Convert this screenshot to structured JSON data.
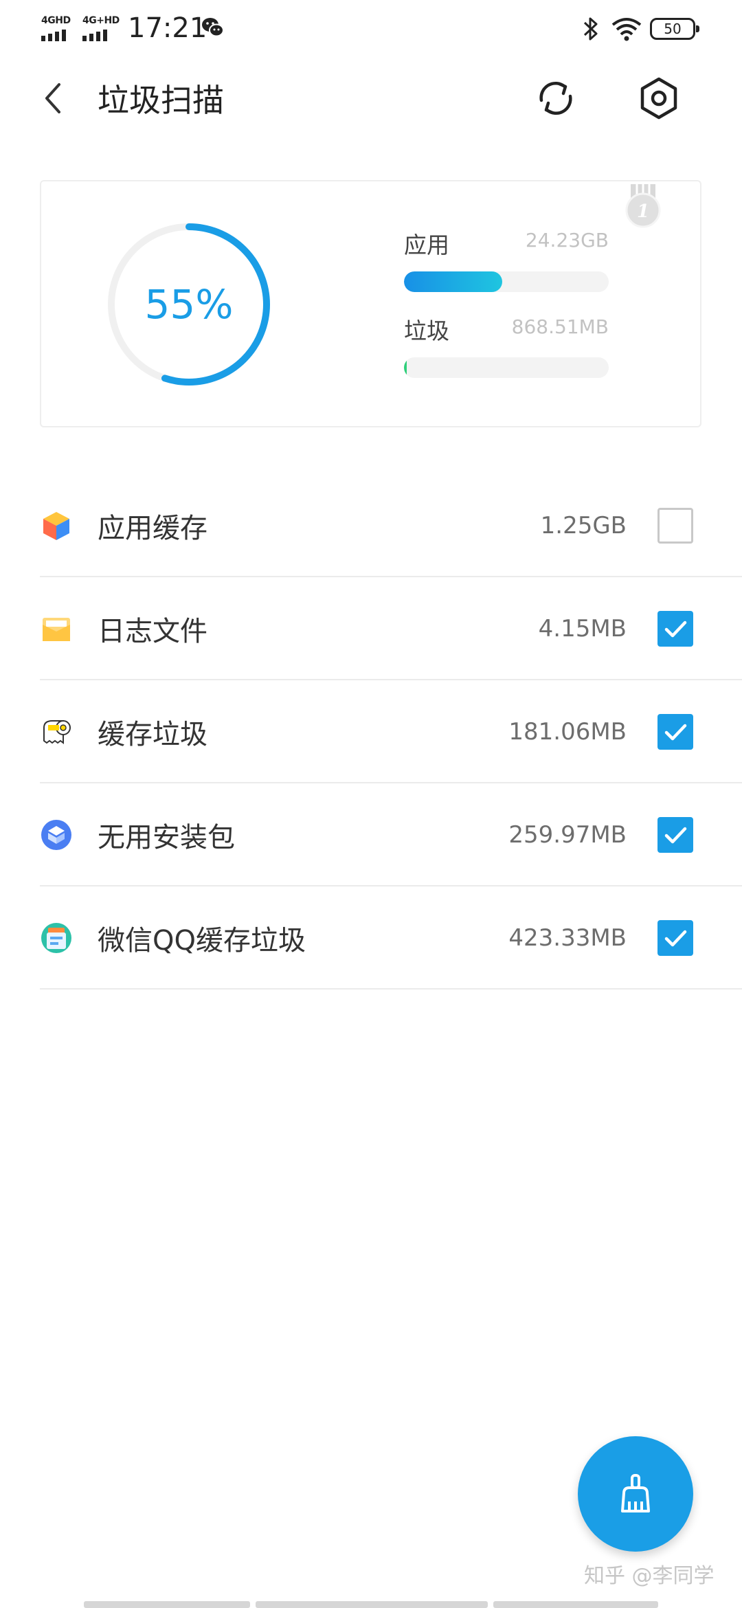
{
  "status_bar": {
    "signal1": "4GHD",
    "signal2": "4G+HD",
    "time": "17:21",
    "battery": "50",
    "icons": [
      "wechat-icon",
      "bluetooth-icon",
      "wifi-icon",
      "battery-icon"
    ]
  },
  "header": {
    "title": "垃圾扫描",
    "back_icon": "back-arrow-icon",
    "refresh_icon": "refresh-icon",
    "settings_icon": "settings-hexagon-icon"
  },
  "summary": {
    "percent_label": "55%",
    "percent_value": 0.55,
    "app_label": "应用",
    "app_value": "24.23GB",
    "app_bar_fraction": 0.48,
    "junk_label": "垃圾",
    "junk_value": "868.51MB",
    "junk_bar_fraction": 0.01,
    "badge": "1"
  },
  "items": [
    {
      "name": "应用缓存",
      "size": "1.25GB",
      "checked": false,
      "icon": "app-cache-cube-icon"
    },
    {
      "name": "日志文件",
      "size": "4.15MB",
      "checked": true,
      "icon": "log-folder-icon"
    },
    {
      "name": "缓存垃圾",
      "size": "181.06MB",
      "checked": true,
      "icon": "toilet-paper-icon"
    },
    {
      "name": "无用安装包",
      "size": "259.97MB",
      "checked": true,
      "icon": "package-icon"
    },
    {
      "name": "微信QQ缓存垃圾",
      "size": "423.33MB",
      "checked": true,
      "icon": "chat-cache-icon"
    }
  ],
  "fab": {
    "icon": "broom-clean-icon"
  },
  "watermark": "知乎 @李同学",
  "colors": {
    "accent": "#1a9de6",
    "junk_bar": "#2fcf7a",
    "divider": "#ebebeb"
  }
}
